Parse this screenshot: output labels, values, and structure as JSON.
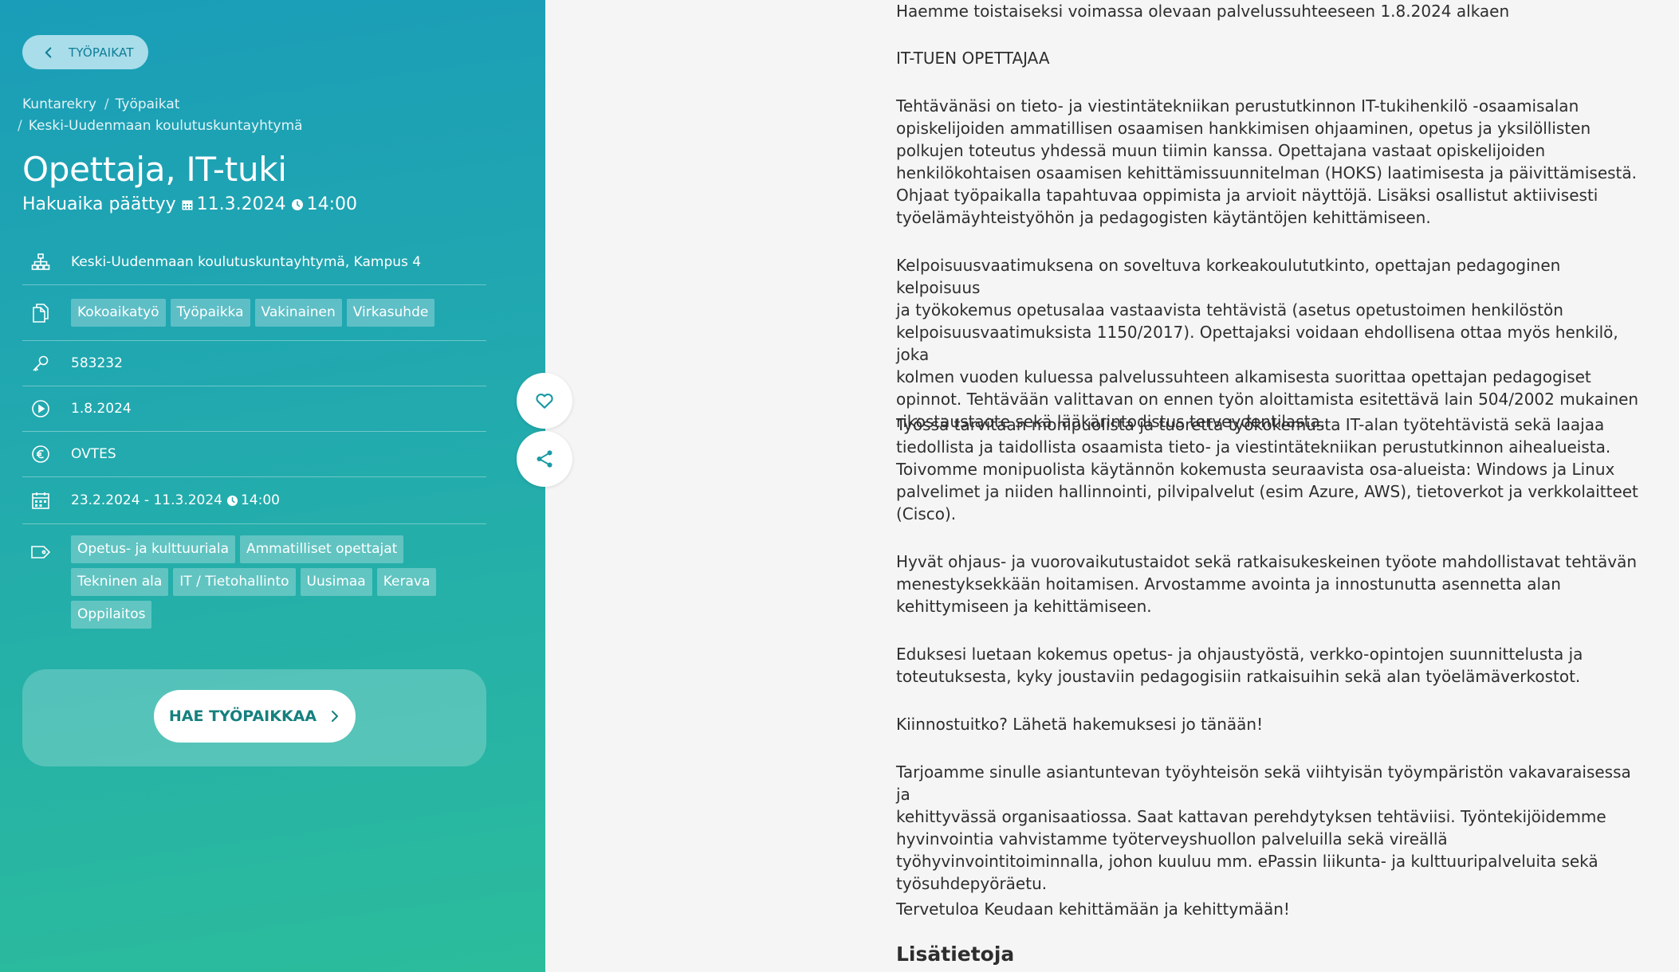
{
  "sidebar": {
    "back_label": "TYÖPAIKAT",
    "breadcrumb": [
      "Kuntarekry",
      "Työpaikat",
      "Keski-Uudenmaan koulutuskuntayhtymä"
    ],
    "breadcrumb_separator": "/",
    "title": "Opettaja, IT-tuki",
    "deadline": {
      "label": "Hakuaika päättyy",
      "date": "11.3.2024",
      "time": "14:00"
    },
    "organization": "Keski-Uudenmaan koulutuskuntayhtymä, Kampus 4",
    "employment_tags": [
      "Kokoaikatyö",
      "Työpaikka",
      "Vakinainen",
      "Virkasuhde"
    ],
    "job_id": "583232",
    "start_date": "1.8.2024",
    "salary": "OVTES",
    "application_period": {
      "range": "23.2.2024 - 11.3.2024",
      "time": "14:00"
    },
    "categories": [
      "Opetus- ja kulttuuriala",
      "Ammatilliset opettajat",
      "Tekninen ala",
      "IT / Tietohallinto",
      "Uusimaa",
      "Kerava",
      "Oppilaitos"
    ],
    "apply_label": "HAE TYÖPAIKKAA",
    "icons": {
      "back": "chevron-left-icon",
      "organization": "org-chart-icon",
      "tags": "documents-icon",
      "job_id": "key-icon",
      "start": "play-circle-icon",
      "salary": "euro-icon",
      "period": "calendar-icon",
      "categories": "tag-icon",
      "apply": "chevron-right-icon",
      "favorite": "heart-icon",
      "share": "share-icon"
    }
  },
  "content": {
    "intro": "Haemme toistaiseksi voimassa olevaan palvelussuhteeseen 1.8.2024 alkaen",
    "role_heading": "IT-TUEN OPETTAJAA",
    "paragraphs": [
      [
        "Tehtävänäsi on tieto- ja viestintätekniikan perustutkinnon IT-tukihenkilö -osaamisalan",
        "opiskelijoiden ammatillisen osaamisen hankkimisen ohjaaminen, opetus ja yksilöllisten",
        "polkujen toteutus yhdessä muun tiimin kanssa. Opettajana vastaat opiskelijoiden",
        "henkilökohtaisen osaamisen kehittämissuunnitelman (HOKS) laatimisesta ja päivittämisestä.",
        "Ohjaat työpaikalla tapahtuvaa oppimista ja arvioit näyttöjä. Lisäksi osallistut aktiivisesti",
        "työelämäyhteistyöhön ja pedagogisten käytäntöjen kehittämiseen."
      ],
      [
        "Kelpoisuusvaatimuksena on soveltuva korkeakoulututkinto, opettajan pedagoginen kelpoisuus",
        "ja työkokemus opetusalaa vastaavista tehtävistä (asetus opetustoimen henkilöstön",
        "kelpoisuusvaatimuksista 1150/2017). Opettajaksi voidaan ehdollisena ottaa myös henkilö, joka",
        "kolmen vuoden kuluessa palvelussuhteen alkamisesta suorittaa opettajan pedagogiset",
        "opinnot. Tehtävään valittavan on ennen työn aloittamista esitettävä lain 504/2002 mukainen",
        "rikostaustaote sekä lääkärintodistus terveydentilasta."
      ],
      [
        "Työssä tarvitaan monipuolista ja tuoretta työkokemusta IT-alan työtehtävistä sekä laajaa",
        "tiedollista ja taidollista osaamista tieto- ja viestintätekniikan perustutkinnon aihealueista.",
        "Toivomme monipuolista käytännön kokemusta seuraavista osa-alueista: Windows ja Linux",
        "palvelimet ja niiden hallinnointi, pilvipalvelut (esim Azure, AWS), tietoverkot ja verkkolaitteet",
        "(Cisco)."
      ],
      [
        "Hyvät ohjaus- ja vuorovaikutustaidot sekä ratkaisukeskeinen työote mahdollistavat tehtävän",
        "menestyksekkään hoitamisen. Arvostamme avointa ja innostunutta asennetta alan",
        "kehittymiseen ja kehittämiseen."
      ],
      [
        "Eduksesi luetaan kokemus opetus- ja ohjaustyöstä, verkko-opintojen suunnittelusta ja",
        "toteutuksesta, kyky joustaviin pedagogisiin ratkaisuihin sekä alan työelämäverkostot."
      ],
      [
        "Kiinnostuitko? Lähetä hakemuksesi jo tänään!"
      ],
      [
        "Tarjoamme sinulle asiantuntevan työyhteisön sekä viihtyisän työympäristön vakavaraisessa ja",
        "kehittyvässä organisaatiossa. Saat kattavan perehdytyksen tehtäviisi. Työntekijöidemme",
        "hyvinvointia vahvistamme työterveyshuollon palveluilla sekä vireällä",
        "työhyvinvointitoiminnalla, johon kuuluu mm. ePassin liikunta- ja kulttuuripalveluita sekä",
        "työsuhdepyöräetu."
      ],
      [
        "Tervetuloa Keudaan kehittämään ja kehittymään!"
      ]
    ],
    "section_heading": "Lisätietoja"
  },
  "colors": {
    "sidebar_gradient_start": "#1a9db8",
    "sidebar_gradient_end": "#2bbc9c",
    "back_button_bg": "#a9ddea",
    "apply_text": "#15807f",
    "content_text": "#2e2e2e",
    "page_bg": "#f5f5f5"
  }
}
